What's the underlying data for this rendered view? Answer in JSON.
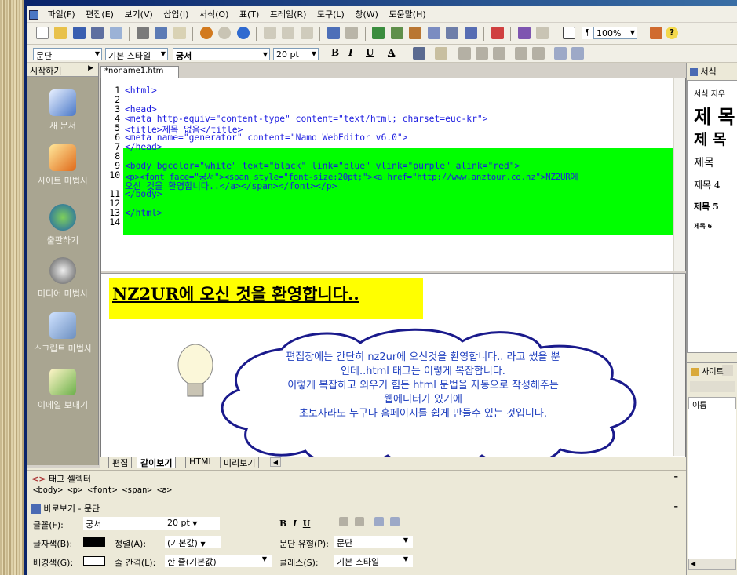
{
  "menu": [
    "파일(F)",
    "편집(E)",
    "보기(V)",
    "삽입(I)",
    "서식(O)",
    "표(T)",
    "프레임(R)",
    "도구(L)",
    "창(W)",
    "도움말(H)"
  ],
  "toolbar": {
    "zoom": "100%"
  },
  "format_bar": {
    "paragraph": "문단",
    "style": "기본 스타일",
    "font": "궁서",
    "size": "20 pt",
    "bold": "B",
    "italic": "I",
    "underline": "U",
    "text_color": "A"
  },
  "sidebar": {
    "header": "시작하기",
    "items": [
      {
        "label": "새 문서",
        "icon": "new-document-icon"
      },
      {
        "label": "사이트 마법사",
        "icon": "site-wizard-icon"
      },
      {
        "label": "출판하기",
        "icon": "publish-icon"
      },
      {
        "label": "미디어 마법사",
        "icon": "media-wizard-icon"
      },
      {
        "label": "스크립트 마법사",
        "icon": "script-wizard-icon"
      },
      {
        "label": "이메일 보내기",
        "icon": "send-email-icon"
      }
    ]
  },
  "document_tab": "*noname1.htm",
  "code_lines": [
    "<html>",
    "",
    "<head>",
    "<meta http-equiv=\"content-type\" content=\"text/html; charset=euc-kr\">",
    "<title>제목 없음</title>",
    "<meta name=\"generator\" content=\"Namo WebEditor v6.0\">",
    "</head>",
    "",
    "<body bgcolor=\"white\" text=\"black\" link=\"blue\" vlink=\"purple\" alink=\"red\">",
    "<p><font face=\"궁서\"><span style=\"font-size:20pt;\"><a href=\"http://www.anztour.co.nz\">NZ2UR에",
    "오신 것을 환영합니다..</a></span></font></p>",
    "</body>",
    "",
    "</html>",
    ""
  ],
  "line_numbers": [
    "1",
    "2",
    "3",
    "4",
    "5",
    "6",
    "7",
    "8",
    "9",
    "10",
    "",
    "11",
    "12",
    "13",
    "14"
  ],
  "preview_headline": "NZ2UR에 오신 것을 환영합니다..",
  "callout_lines": [
    "편집장에는 간단히 nz2ur에 오신것을 환영합니다.. 라고 썼을 뿐",
    "인데..html 태그는 이렇게 복잡합니다.",
    "이렇게 복잡하고 외우기 힘든 html 문법을 자동으로 작성해주는",
    "웹에디터가 있기에",
    "초보자라도 누구나 홈페이지를 쉽게 만들수 있는 것입니다."
  ],
  "view_tabs": [
    "편집",
    "같이보기",
    "HTML",
    "미리보기"
  ],
  "tag_selector": {
    "title": "태그 셀렉터",
    "path": "<body> <p> <font> <span> <a>"
  },
  "quick_view": {
    "title": "바로보기 - 문단",
    "font_label": "글꼴(F):",
    "font_value": "궁서",
    "size_value": "20 pt",
    "text_color_label": "글자색(B):",
    "align_label": "정렬(A):",
    "align_value": "(기본값)",
    "para_type_label": "문단 유형(P):",
    "para_type_value": "문단",
    "bg_color_label": "배경색(G):",
    "line_spacing_label": "줄 간격(L):",
    "line_spacing_value": "한 줄(기본값)",
    "class_label": "클래스(S):",
    "class_value": "기본 스타일"
  },
  "right_panel": {
    "header": "서식",
    "clear": "서식 지우",
    "styles": [
      "제 목",
      "제 목",
      "제목",
      "제목 4",
      "제목 5",
      "제목 6"
    ],
    "site_header": "사이트",
    "name_col": "이름"
  },
  "colors": {
    "highlight": "#00ff00",
    "preview_bg": "#ffff00",
    "callout_text": "#1f3fbf"
  }
}
